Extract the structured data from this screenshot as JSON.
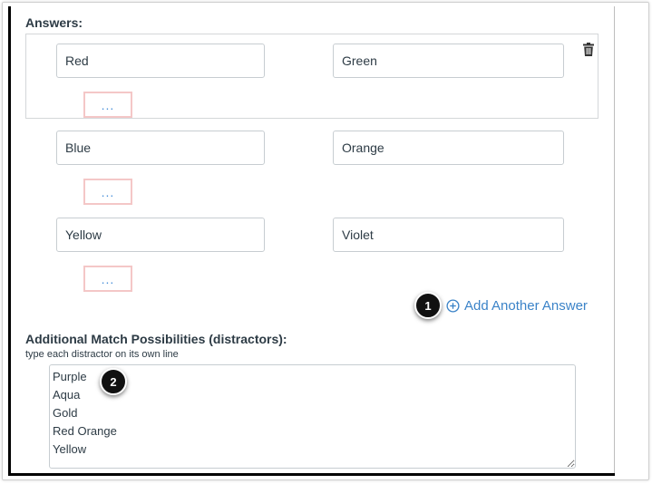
{
  "answers_label": "Answers:",
  "answers": [
    {
      "left": "Red",
      "right": "Green",
      "more_label": "..."
    },
    {
      "left": "Blue",
      "right": "Orange",
      "more_label": "..."
    },
    {
      "left": "Yellow",
      "right": "Violet",
      "more_label": "..."
    }
  ],
  "add_answer": {
    "label": "Add Another Answer",
    "icon": "plus-circle-icon"
  },
  "distractors": {
    "label": "Additional Match Possibilities (distractors):",
    "hint": "type each distractor on its own line",
    "value": "Purple\nAqua\nGold\nRed Orange\nYellow"
  },
  "callouts": [
    "1",
    "2"
  ],
  "delete_icon": "trash-icon",
  "colors": {
    "link": "#3b83c8",
    "text": "#2d3b45",
    "more_border": "#f4c7c7"
  }
}
